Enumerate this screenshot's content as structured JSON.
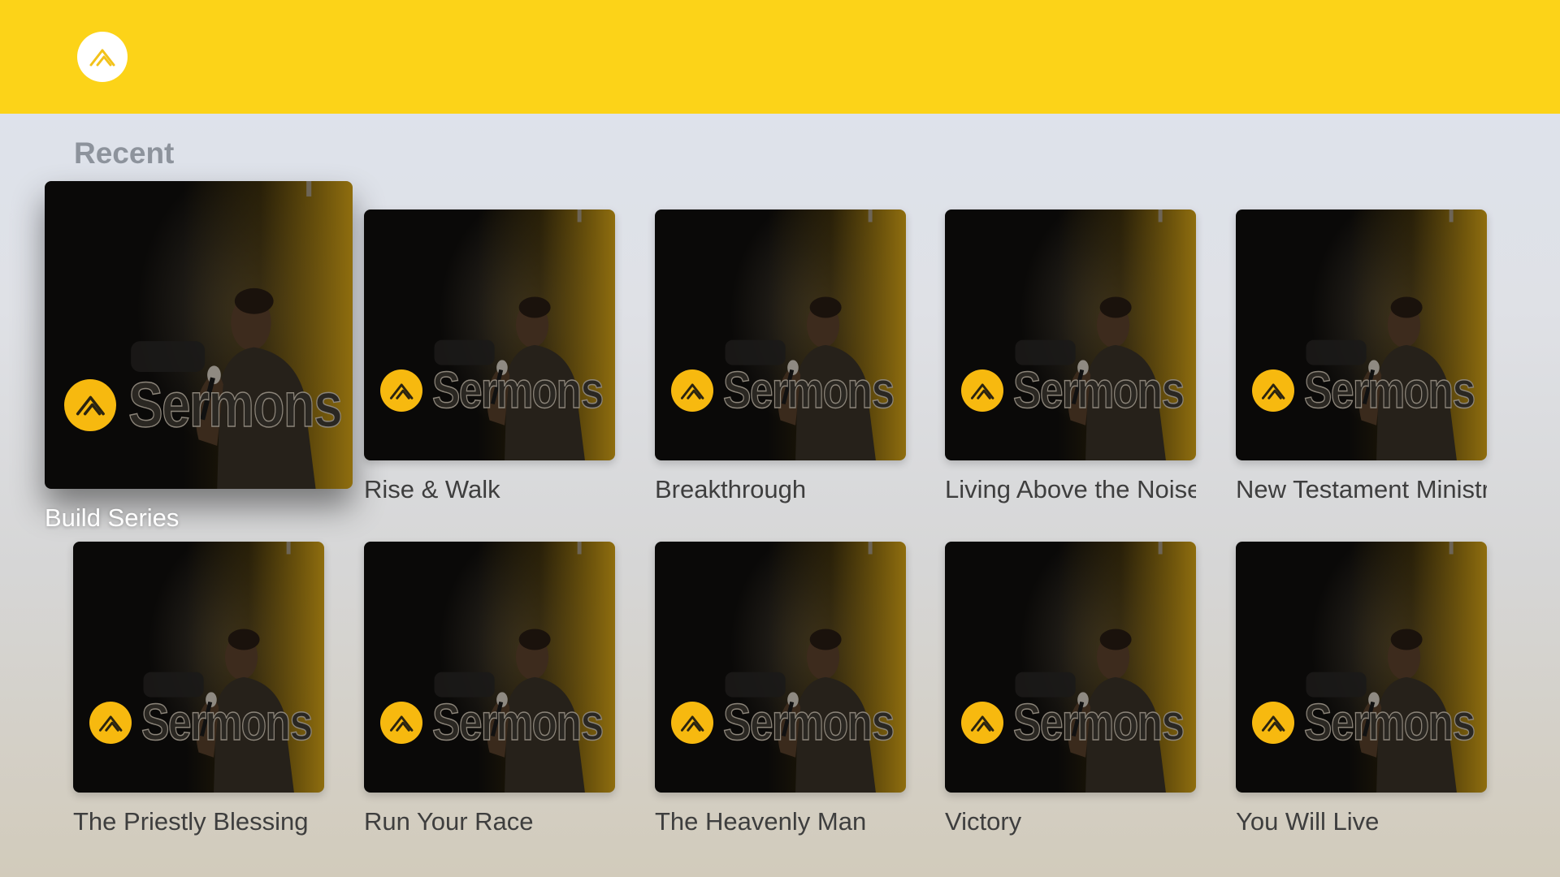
{
  "header": {
    "logo_icon": "church-logo-icon",
    "background_color": "#fcd318"
  },
  "section": {
    "title": "Recent"
  },
  "tile_branding": {
    "wordmark": "Sermons",
    "accent_color": "#f7b90f"
  },
  "sermons": [
    {
      "title": "Build Series",
      "focused": true
    },
    {
      "title": "Rise & Walk",
      "focused": false
    },
    {
      "title": "Breakthrough",
      "focused": false
    },
    {
      "title": "Living Above the Noise",
      "focused": false
    },
    {
      "title": "New Testament Ministry",
      "focused": false
    },
    {
      "title": "The Priestly Blessing",
      "focused": false
    },
    {
      "title": "Run Your Race",
      "focused": false
    },
    {
      "title": "The Heavenly Man",
      "focused": false
    },
    {
      "title": "Victory",
      "focused": false
    },
    {
      "title": "You Will Live",
      "focused": false
    }
  ]
}
